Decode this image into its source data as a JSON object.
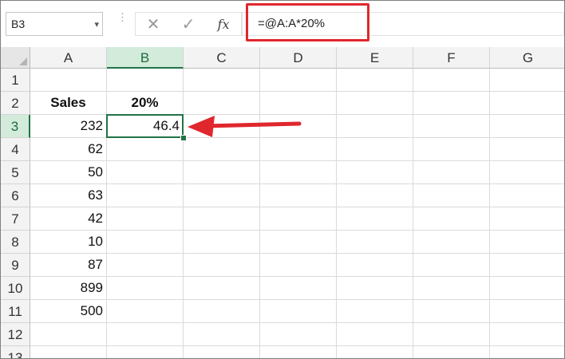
{
  "formula_bar": {
    "name_box": "B3",
    "name_box_dropdown": "▾",
    "separator": "⋮",
    "cancel_icon": "✕",
    "enter_icon": "✓",
    "function_icon": "fx",
    "formula": "=@A:A*20%"
  },
  "columns": [
    "A",
    "B",
    "C",
    "D",
    "E",
    "F",
    "G"
  ],
  "rows": [
    "1",
    "2",
    "3",
    "4",
    "5",
    "6",
    "7",
    "8",
    "9",
    "10",
    "11",
    "12",
    "13"
  ],
  "selected_cell": "B3",
  "cells": {
    "A2": "Sales",
    "B2": "20%",
    "A3": "232",
    "B3": "46.4",
    "A4": "62",
    "A5": "50",
    "A6": "63",
    "A7": "42",
    "A8": "10",
    "A9": "87",
    "A10": "899",
    "A11": "500"
  },
  "annotation": {
    "highlight_color": "#e0272d",
    "arrow_color": "#e0272d"
  },
  "colors": {
    "excel_green": "#217346",
    "selected_header_bg": "#d3ebdb"
  }
}
